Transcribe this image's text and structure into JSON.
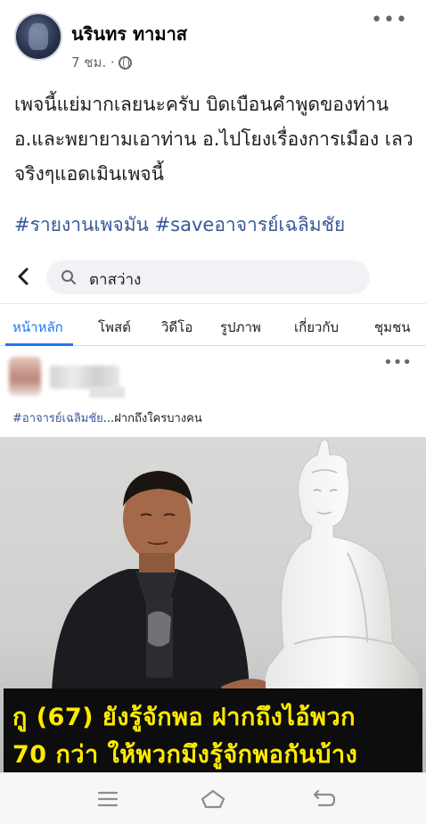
{
  "post": {
    "author": "นรินทร ทามาส",
    "time": "7 ชม. ·",
    "privacy_icon": "globe-icon",
    "text": "เพจนี้แย่มากเลยนะครับ บิดเบือนคำพูดของท่าน อ.และพยายามเอาท่าน อ.ไปโยงเรื่องการเมือง เลวจริงๆแอดเมินเพจนี้",
    "hashtags": "#รายงานเพจมัน #saveอาจารย์เฉลิมชัย"
  },
  "shared_page": {
    "search": {
      "value": "ตาสว่าง"
    },
    "tabs": [
      "หน้าหลัก",
      "โพสต์",
      "วิดีโอ",
      "รูปภาพ",
      "เกี่ยวกับ",
      "ชุมชน"
    ],
    "active_tab": "หน้าหลัก",
    "inner_post": {
      "caption_tag": "#อาจารย์เฉลิมชัย",
      "caption_rest": "...ฝากถึงใครบางคน"
    },
    "image_caption": {
      "line1": "กู (67) ยังรู้จักพอ ฝากถึงไอ้พวก",
      "line2": "70 กว่า ให้พวกมึงรู้จักพอกันบ้าง"
    }
  },
  "colors": {
    "link": "#385898",
    "active_tab": "#1877f2",
    "caption_text": "#ffea00",
    "caption_bg": "#0d0d0d"
  }
}
